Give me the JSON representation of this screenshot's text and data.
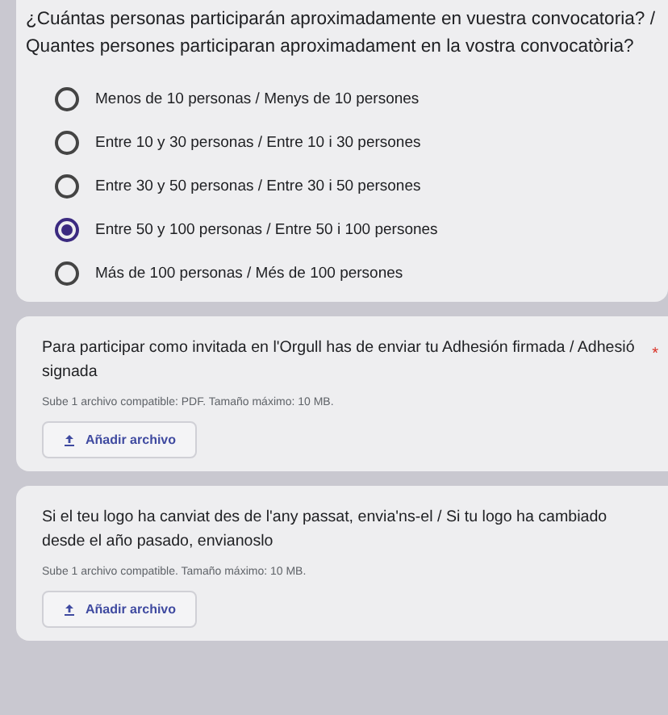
{
  "questions": [
    {
      "kind": "choice",
      "title": "¿Cuántas personas participarán aproximadamente en vuestra convocatoria? / Quantes persones participaran aproximadament en la vostra convocatòria?",
      "options": [
        {
          "label": "Menos de 10 personas / Menys de 10 persones",
          "selected": false
        },
        {
          "label": "Entre 10 y 30 personas / Entre 10 i 30 persones",
          "selected": false
        },
        {
          "label": "Entre 30 y 50 personas  / Entre 30 i 50 persones",
          "selected": false
        },
        {
          "label": "Entre 50 y 100 personas  / Entre 50 i 100 persones",
          "selected": true
        },
        {
          "label": "Más de 100 personas / Més de 100 persones",
          "selected": false
        }
      ]
    },
    {
      "kind": "upload",
      "title": "Para participar como invitada en l'Orgull has de enviar tu Adhesión firmada / Adhesió signada",
      "required_mark": "*",
      "hint": "Sube 1 archivo compatible: PDF. Tamaño máximo: 10 MB.",
      "button": "Añadir archivo"
    },
    {
      "kind": "upload",
      "title": "Si el teu logo ha canviat des de l'any passat, envia'ns-el / Si tu logo ha cambiado desde el año pasado, envianoslo",
      "hint": "Sube 1 archivo compatible. Tamaño máximo: 10 MB.",
      "button": "Añadir archivo"
    }
  ]
}
